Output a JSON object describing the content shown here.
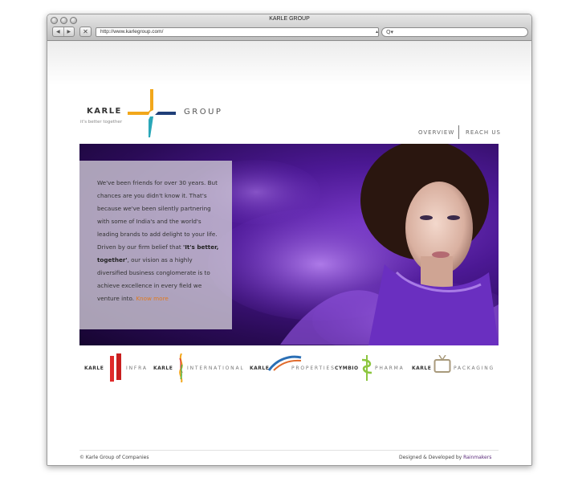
{
  "browser": {
    "window_title": "KARLE GROUP",
    "url": "http://www.karlegroup.com/",
    "search_placeholder": "Q▾"
  },
  "site": {
    "logo": {
      "name": "KARLE",
      "group": "GROUP",
      "tagline": "it's better together"
    },
    "nav": {
      "overview": "OVERVIEW",
      "reach_us": "REACH US"
    },
    "hero": {
      "intro": "We've been friends for over 30 years. But chances are you didn't know it. That's because we've been silently partnering with some of India's and the world's leading brands to add delight to your life. Driven by our firm belief that ",
      "emphasis": "'It's better, together'",
      "closing": ",  our vision as a highly diversified business conglomerate is to achieve excellence in every field we venture into.",
      "more_link": "Know more"
    },
    "brands": [
      {
        "prefix": "KARLE",
        "suffix": "INFRA",
        "color": "#e02b2b"
      },
      {
        "prefix": "KARLE",
        "suffix": "INTERNATIONAL",
        "color": "#f2a71b"
      },
      {
        "prefix": "KARLE",
        "suffix": "PROPERTIES",
        "color": "#2b6fb5"
      },
      {
        "prefix": "CYMBIO",
        "suffix": "PHARMA",
        "color": "#8cc63f"
      },
      {
        "prefix": "KARLE",
        "suffix": "PACKAGING",
        "color": "#a89a7c"
      }
    ],
    "footer": {
      "copyright": "© Karle Group of Companies",
      "credit": "Designed & Developed by ",
      "credit_name": "Rainmakers"
    }
  },
  "colors": {
    "accent_orange": "#e07a1f",
    "hero_purple": "#4b1893"
  }
}
